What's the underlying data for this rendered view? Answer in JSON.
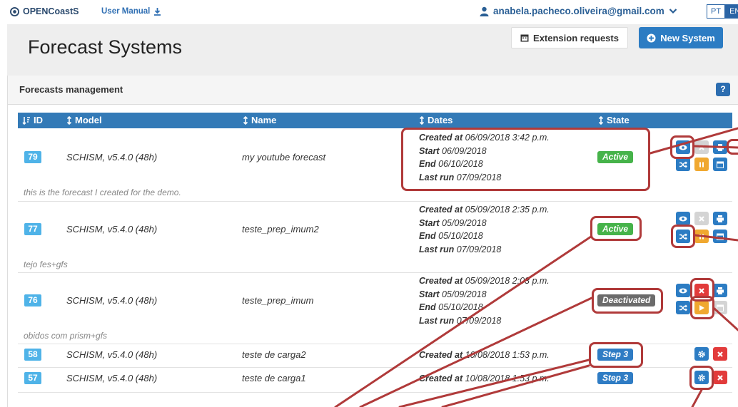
{
  "topbar": {
    "brand": "OPENCoastS",
    "manual": "User Manual",
    "user_email": "anabela.pacheco.oliveira@gmail.com",
    "lang_pt": "PT",
    "lang_en": "EN"
  },
  "header": {
    "title": "Forecast Systems",
    "extension_requests": "Extension requests",
    "new_system": "New System"
  },
  "panel": {
    "title": "Forecasts management",
    "help": "?"
  },
  "columns": {
    "id": "ID",
    "model": "Model",
    "name": "Name",
    "dates": "Dates",
    "state": "State"
  },
  "labels": {
    "created_at": "Created at",
    "start": "Start",
    "end": "End",
    "last_run": "Last run"
  },
  "rows": [
    {
      "id": "79",
      "model": "SCHISM, v5.4.0 (48h)",
      "name": "my youtube forecast",
      "created": "06/09/2018 3:42 p.m.",
      "start": "06/09/2018",
      "end": "06/10/2018",
      "last_run": "07/09/2018",
      "state": "Active",
      "description": "this is the forecast I created for the demo."
    },
    {
      "id": "77",
      "model": "SCHISM, v5.4.0 (48h)",
      "name": "teste_prep_imum2",
      "created": "05/09/2018 2:35 p.m.",
      "start": "05/09/2018",
      "end": "05/10/2018",
      "last_run": "07/09/2018",
      "state": "Active",
      "description": "tejo fes+gfs"
    },
    {
      "id": "76",
      "model": "SCHISM, v5.4.0 (48h)",
      "name": "teste_prep_imum",
      "created": "05/09/2018 2:03 p.m.",
      "start": "05/09/2018",
      "end": "05/10/2018",
      "last_run": "07/09/2018",
      "state": "Deactivated",
      "description": "obidos com prism+gfs"
    },
    {
      "id": "58",
      "model": "SCHISM, v5.4.0 (48h)",
      "name": "teste de carga2",
      "created": "10/08/2018 1:53 p.m.",
      "state": "Step 3"
    },
    {
      "id": "57",
      "model": "SCHISM, v5.4.0 (48h)",
      "name": "teste de carga1",
      "created": "10/08/2018 1:53 p.m.",
      "state": "Step 3"
    }
  ],
  "colors": {
    "primary": "#2c7cc3",
    "table_header": "#337ab7",
    "active": "#46b34a",
    "deactivated": "#6b6b6b",
    "danger": "#e23b3b",
    "warning": "#f0a830",
    "id_badge": "#4fb3e8",
    "annotation": "#b03a3a"
  },
  "icons": [
    "brand-logo-icon",
    "download-icon",
    "user-icon",
    "chevron-down-icon",
    "calendar-icon",
    "plus-circle-icon",
    "sort-icon",
    "view-eye-icon",
    "delete-x-icon",
    "print-icon",
    "shuffle-icon",
    "pause-icon",
    "play-icon",
    "gear-icon",
    "question-icon"
  ]
}
